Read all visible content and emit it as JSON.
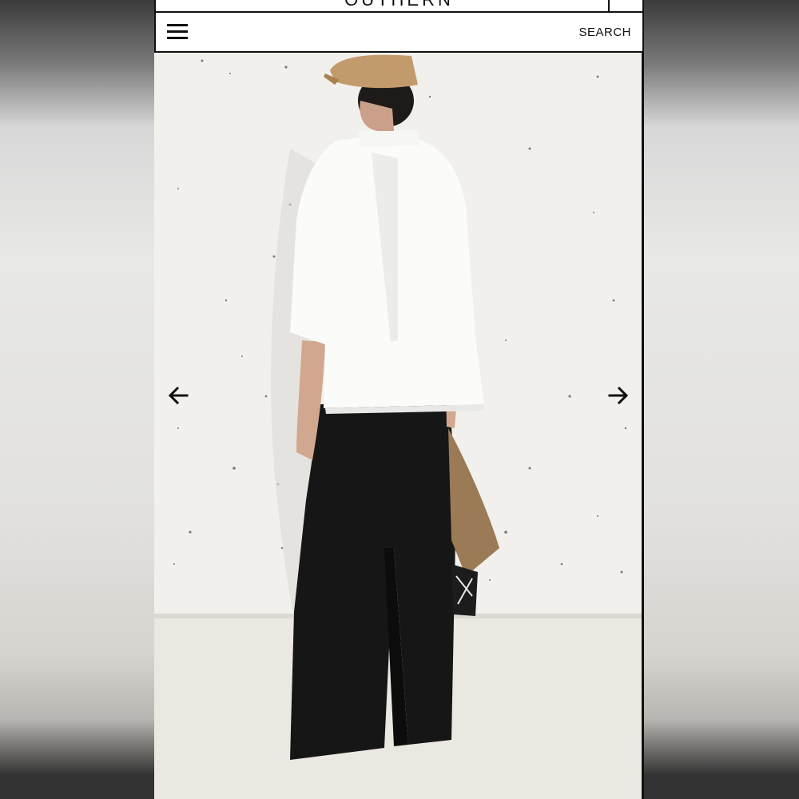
{
  "header": {
    "logo_partial": "OUTHERN"
  },
  "navbar": {
    "menu_icon": "hamburger-menu-icon",
    "search_label": "SEARCH"
  },
  "gallery": {
    "prev_icon": "arrow-left-icon",
    "next_icon": "arrow-right-icon"
  },
  "colors": {
    "border": "#111111",
    "background": "#ffffff"
  }
}
